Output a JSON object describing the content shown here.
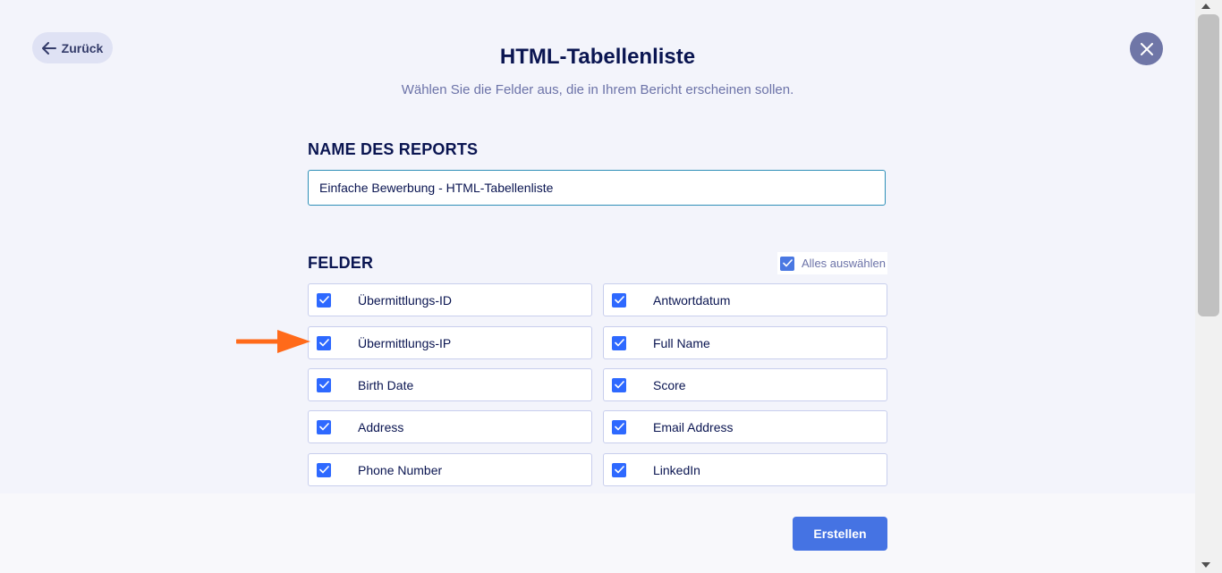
{
  "header": {
    "back_label": "Zurück",
    "title": "HTML-Tabellenliste",
    "subtitle": "Wählen Sie die Felder aus, die in Ihrem Bericht erscheinen sollen."
  },
  "report_name": {
    "label": "NAME DES REPORTS",
    "value": "Einfache Bewerbung - HTML-Tabellenliste"
  },
  "fields_section": {
    "label": "FELDER",
    "select_all_label": "Alles auswählen",
    "select_all_checked": true,
    "fields": [
      {
        "label": "Übermittlungs-ID",
        "checked": true
      },
      {
        "label": "Antwortdatum",
        "checked": true
      },
      {
        "label": "Übermittlungs-IP",
        "checked": true
      },
      {
        "label": "Full Name",
        "checked": true
      },
      {
        "label": "Birth Date",
        "checked": true
      },
      {
        "label": "Score",
        "checked": true
      },
      {
        "label": "Address",
        "checked": true
      },
      {
        "label": "Email Address",
        "checked": true
      },
      {
        "label": "Phone Number",
        "checked": true
      },
      {
        "label": "LinkedIn",
        "checked": true
      }
    ]
  },
  "footer": {
    "create_label": "Erstellen"
  },
  "colors": {
    "accent": "#4573e3",
    "checkbox": "#2e69ff",
    "annotation_arrow": "#ff6a1a",
    "title": "#0a1551"
  },
  "icons": [
    "arrow-left-icon",
    "close-icon",
    "check-icon",
    "annotation-arrow-icon",
    "scroll-up-icon",
    "scroll-down-icon"
  ]
}
